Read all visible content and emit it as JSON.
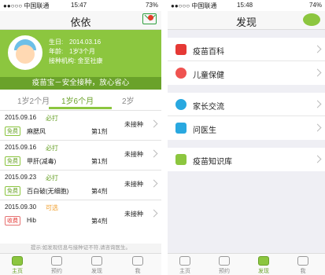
{
  "left": {
    "status": {
      "carrier": "●●○○○ 中国联通",
      "time": "15:47",
      "battery": "73%"
    },
    "title": "依依",
    "profile": {
      "birth_label": "生日:",
      "birth": "2014.03.16",
      "age_label": "年龄:",
      "age": "1岁3个月",
      "org_label": "接种机构:",
      "org": "金至社康"
    },
    "slogan": "疫苗宝－安全接种，放心省心",
    "tabs": [
      "1岁2个月",
      "1岁6个月",
      "2岁"
    ],
    "rows": [
      {
        "date": "2015.09.16",
        "tag": "必打",
        "badge": "免费",
        "name": "麻腮风",
        "dose": "第1剂",
        "status": "未接种"
      },
      {
        "date": "2015.09.16",
        "tag": "必打",
        "badge": "免费",
        "name": "甲肝(减毒)",
        "dose": "第1剂",
        "status": "未接种"
      },
      {
        "date": "2015.09.23",
        "tag": "必打",
        "badge": "免费",
        "name": "百白破(无细胞)",
        "dose": "第4剂",
        "status": "未接种"
      },
      {
        "date": "2015.09.30",
        "tag": "可选",
        "badge": "收费",
        "name": "Hib",
        "dose": "第4剂",
        "status": "未接种"
      }
    ],
    "tip": "提示:如发现信息与接种证不符,请咨询医生。",
    "tabbar": [
      "主页",
      "预约",
      "发现",
      "我"
    ]
  },
  "right": {
    "status": {
      "carrier": "●●○○○ 中国联通",
      "time": "15:48",
      "battery": "74%"
    },
    "title": "发现",
    "groups": [
      [
        "疫苗百科",
        "儿童保健"
      ],
      [
        "家长交流",
        "问医生"
      ],
      [
        "疫苗知识库"
      ]
    ],
    "tabbar": [
      "主页",
      "预约",
      "发现",
      "我"
    ]
  },
  "colors": {
    "brand": "#8cc63f",
    "brand_dark": "#6aa22a",
    "alert": "#e43c2b"
  }
}
